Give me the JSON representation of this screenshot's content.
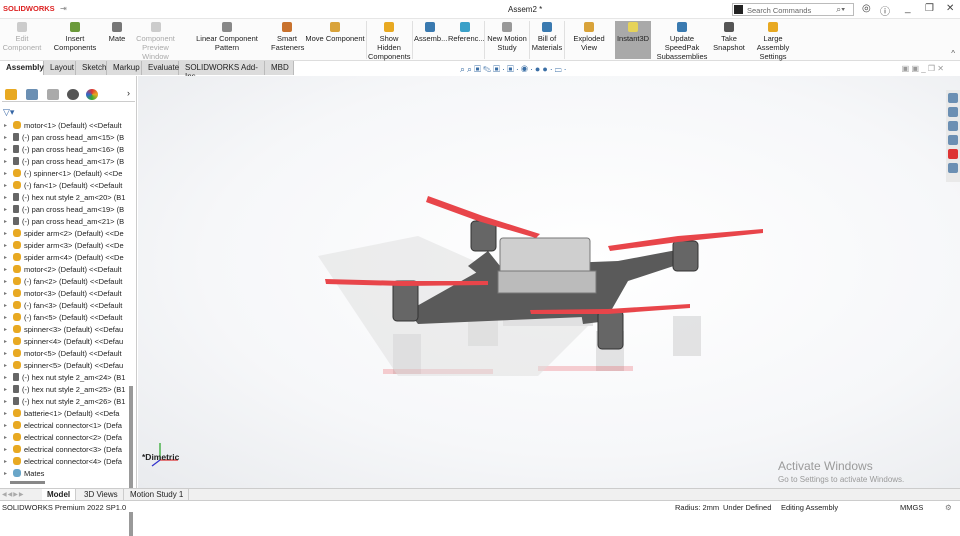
{
  "app": {
    "logo": "SOLIDWORKS",
    "document_title": "Assem2 *"
  },
  "search": {
    "placeholder": "Search Commands"
  },
  "ribbon": [
    {
      "label": "Edit Component",
      "disabled": true
    },
    {
      "label": "Insert Components"
    },
    {
      "label": "Mate"
    },
    {
      "label": "Component Preview Window",
      "disabled": true
    },
    {
      "label": "Linear Component Pattern"
    },
    {
      "label": "Smart Fasteners"
    },
    {
      "label": "Move Component"
    },
    {
      "label": "Show Hidden Components"
    },
    {
      "label": "Assemb..."
    },
    {
      "label": "Referenc..."
    },
    {
      "label": "New Motion Study"
    },
    {
      "label": "Bill of Materials"
    },
    {
      "label": "Exploded View"
    },
    {
      "label": "Instant3D",
      "active": true
    },
    {
      "label": "Update SpeedPak Subassemblies"
    },
    {
      "label": "Take Snapshot"
    },
    {
      "label": "Large Assembly Settings"
    }
  ],
  "command_tabs": [
    "Assembly",
    "Layout",
    "Sketch",
    "Markup",
    "Evaluate",
    "SOLIDWORKS Add-Ins",
    "MBD"
  ],
  "tree": [
    {
      "label": "motor<1> (Default) <<Default",
      "type": "part"
    },
    {
      "label": "(-) pan cross head_am<15> (B",
      "type": "fastener"
    },
    {
      "label": "(-) pan cross head_am<16> (B",
      "type": "fastener"
    },
    {
      "label": "(-) pan cross head_am<17> (B",
      "type": "fastener"
    },
    {
      "label": "(-) spinner<1> (Default) <<De",
      "type": "part"
    },
    {
      "label": "(-) fan<1> (Default) <<Default",
      "type": "part"
    },
    {
      "label": "(-) hex nut style 2_am<20> (B1",
      "type": "fastener"
    },
    {
      "label": "(-) pan cross head_am<19> (B",
      "type": "fastener"
    },
    {
      "label": "(-) pan cross head_am<21> (B",
      "type": "fastener"
    },
    {
      "label": "spider arm<2> (Default) <<De",
      "type": "part"
    },
    {
      "label": "spider arm<3> (Default) <<De",
      "type": "part"
    },
    {
      "label": "spider arm<4> (Default) <<De",
      "type": "part"
    },
    {
      "label": "motor<2> (Default) <<Default",
      "type": "part"
    },
    {
      "label": "(-) fan<2> (Default) <<Default",
      "type": "part"
    },
    {
      "label": "motor<3> (Default) <<Default",
      "type": "part"
    },
    {
      "label": "(-) fan<3> (Default) <<Default",
      "type": "part"
    },
    {
      "label": "(-) fan<5> (Default) <<Default",
      "type": "part"
    },
    {
      "label": "spinner<3> (Default) <<Defau",
      "type": "part"
    },
    {
      "label": "spinner<4> (Default) <<Defau",
      "type": "part"
    },
    {
      "label": "motor<5> (Default) <<Default",
      "type": "part"
    },
    {
      "label": "spinner<5> (Default) <<Defau",
      "type": "part"
    },
    {
      "label": "(-) hex nut style 2_am<24> (B1",
      "type": "fastener"
    },
    {
      "label": "(-) hex nut style 2_am<25> (B1",
      "type": "fastener"
    },
    {
      "label": "(-) hex nut style 2_am<26> (B1",
      "type": "fastener"
    },
    {
      "label": "batterie<1> (Default) <<Defa",
      "type": "part"
    },
    {
      "label": "electrical connector<1> (Defa",
      "type": "part"
    },
    {
      "label": "electrical connector<2> (Defa",
      "type": "part"
    },
    {
      "label": "electrical connector<3> (Defa",
      "type": "part"
    },
    {
      "label": "electrical connector<4> (Defa",
      "type": "part"
    },
    {
      "label": "Mates",
      "type": "mates"
    }
  ],
  "viewport": {
    "view_label": "*Dimetric",
    "watermark_title": "Activate Windows",
    "watermark_text": "Go to Settings to activate Windows."
  },
  "bottom_tabs": [
    "Model",
    "3D Views",
    "Motion Study 1"
  ],
  "status": {
    "product": "SOLIDWORKS Premium 2022 SP1.0",
    "radius": "Radius: 2mm",
    "definition": "Under Defined",
    "mode": "Editing Assembly",
    "units": "MMGS"
  },
  "colors": {
    "propeller": "#e8454a",
    "accent": "#d22222"
  }
}
